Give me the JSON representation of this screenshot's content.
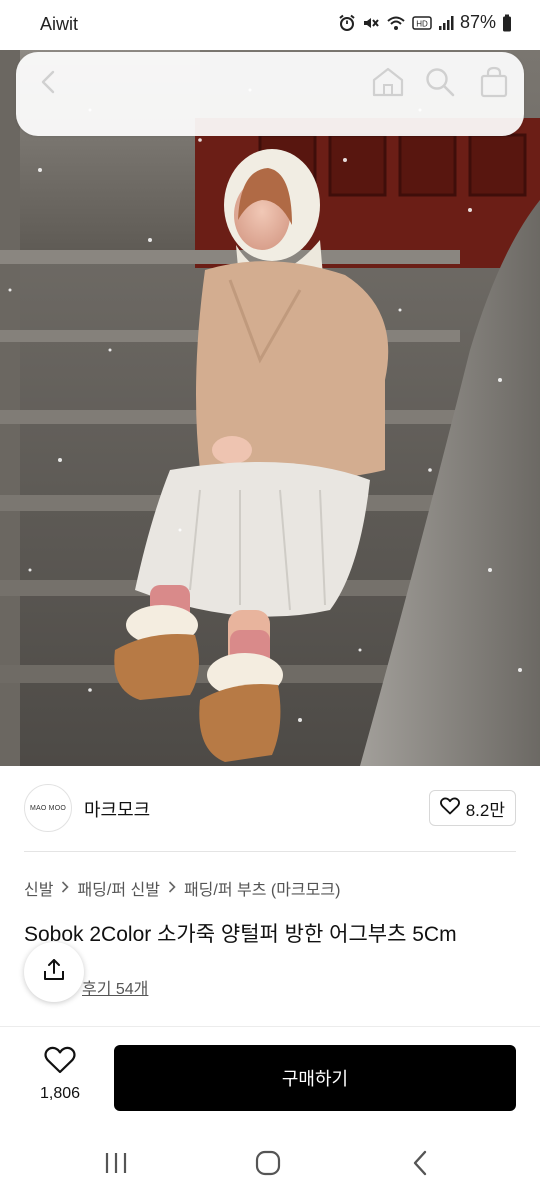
{
  "status_bar": {
    "carrier": "Aiwit",
    "battery": "87%"
  },
  "header": {
    "icons": [
      "back-icon",
      "home-icon",
      "search-icon",
      "cart-icon"
    ]
  },
  "store": {
    "logo_text": "MAO MOO",
    "name": "마크모크",
    "like_count": "8.2만"
  },
  "breadcrumb": [
    "신발",
    "패딩/퍼 신발",
    "패딩/퍼 부츠 (마크모크)"
  ],
  "product": {
    "title": "Sobok 2Color 소가죽 양털퍼 방한 어그부츠 5Cm",
    "reviews_label": "후기 54개"
  },
  "bottom_bar": {
    "like_count": "1,806",
    "buy_label": "구매하기"
  },
  "colors": {
    "buy_button": "#000000",
    "background": "#ffffff"
  }
}
